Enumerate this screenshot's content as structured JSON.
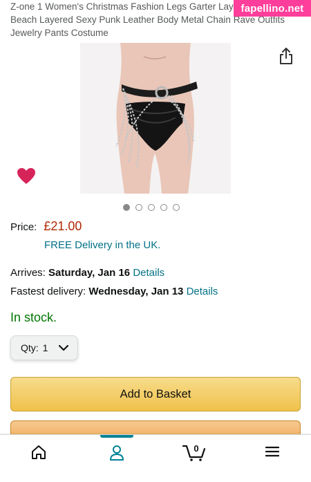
{
  "product": {
    "title": "Z-one 1 Women's Christmas Fashion Legs Garter Layered Harajuku Beach Layered Sexy Punk Leather Body Metal Chain Rave Outfits Jewelry Pants Costume"
  },
  "watermark": "fapellino.net",
  "gallery": {
    "image_count": 5,
    "active_index": 0
  },
  "price": {
    "label": "Price:",
    "value": "£21.00"
  },
  "delivery": {
    "free_text": "FREE Delivery in the UK.",
    "arrives_label": "Arrives:",
    "arrives_date": "Saturday, Jan 16",
    "fastest_label": "Fastest delivery:",
    "fastest_date": "Wednesday, Jan 13",
    "details_link": "Details"
  },
  "stock_status": "In stock.",
  "quantity": {
    "label": "Qty:",
    "value": "1"
  },
  "buttons": {
    "add_to_basket": "Add to Basket"
  },
  "cart": {
    "count": "0"
  },
  "icons": {
    "share": "share-icon",
    "wishlist": "heart-icon",
    "home": "home-icon",
    "account": "person-icon",
    "cart": "cart-icon",
    "menu": "hamburger-menu-icon"
  },
  "colors": {
    "price": "#b12704",
    "link": "#007185",
    "stock": "#007600",
    "basket_button": "#f0c14b",
    "heart": "#d6245a",
    "watermark_bg": "#ff3d9a"
  }
}
